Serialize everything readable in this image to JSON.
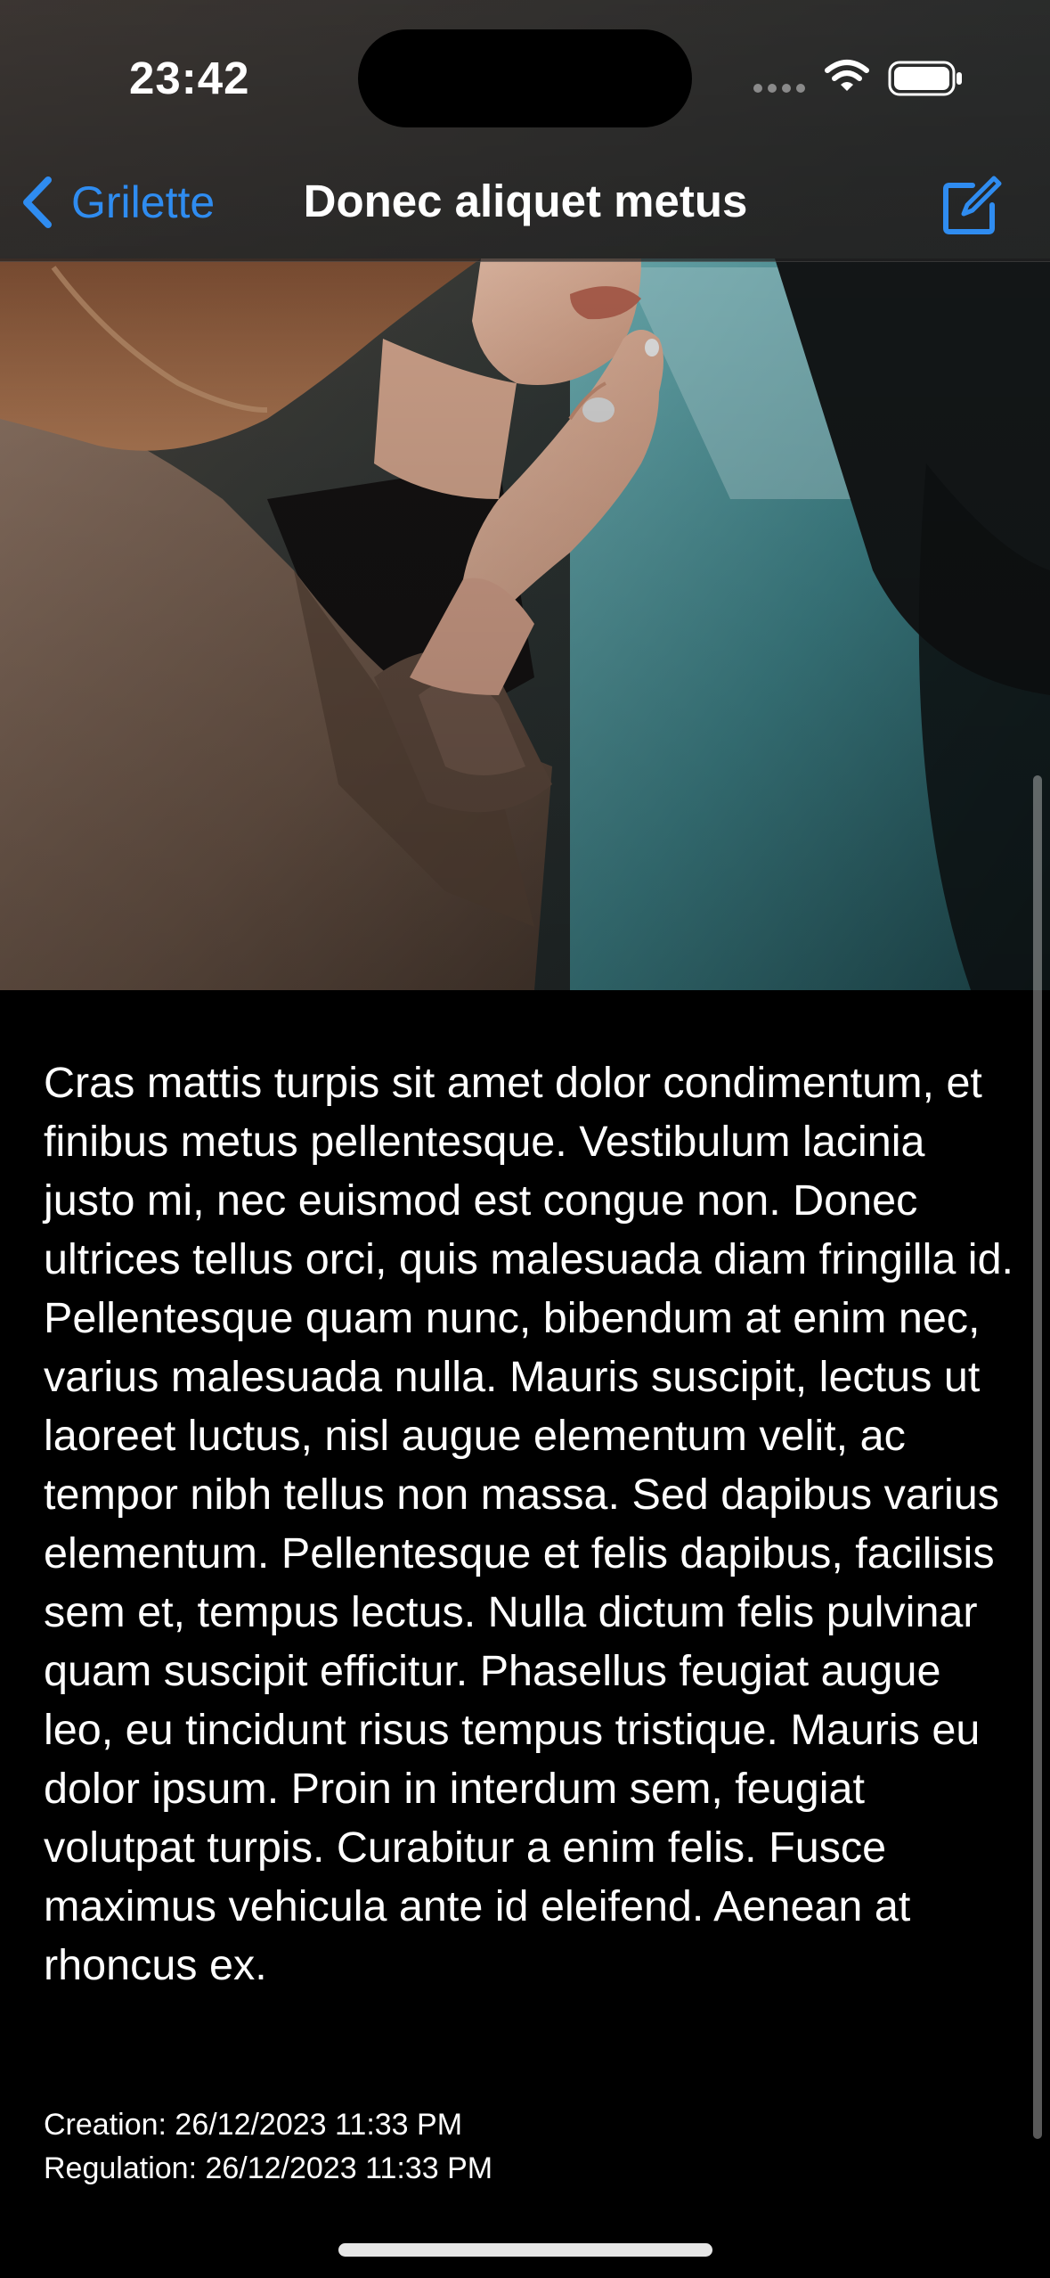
{
  "status_bar": {
    "time": "23:42"
  },
  "nav": {
    "back_label": "Grilette",
    "title": "Donec aliquet metus",
    "compose_icon": "square-and-pencil-icon"
  },
  "colors": {
    "accent": "#2f8cf0",
    "background": "#000000",
    "text": "#ffffff"
  },
  "article": {
    "body": "Cras mattis turpis sit amet dolor condimentum, et finibus metus pellentesque. Vestibulum lacinia justo mi, nec euismod est congue non. Donec ultrices tellus orci, quis malesuada diam fringilla id. Pellentesque quam nunc, bibendum at enim nec, varius malesuada nulla. Mauris suscipit, lectus ut laoreet luctus, nisl augue elementum velit, ac tempor nibh tellus non massa. Sed dapibus varius elementum. Pellentesque et felis dapibus, facilisis sem et, tempus lectus. Nulla dictum felis pulvinar quam suscipit efficitur. Phasellus feugiat augue leo, eu tincidunt risus tempus tristique. Mauris eu dolor ipsum. Proin in interdum sem, feugiat volutpat turpis. Curabitur a enim felis. Fusce maximus vehicula ante id eleifend. Aenean at rhoncus ex."
  },
  "meta": {
    "creation": "Creation: 26/12/2023 11:33 PM",
    "regulation": "Regulation: 26/12/2023 11:33 PM"
  }
}
